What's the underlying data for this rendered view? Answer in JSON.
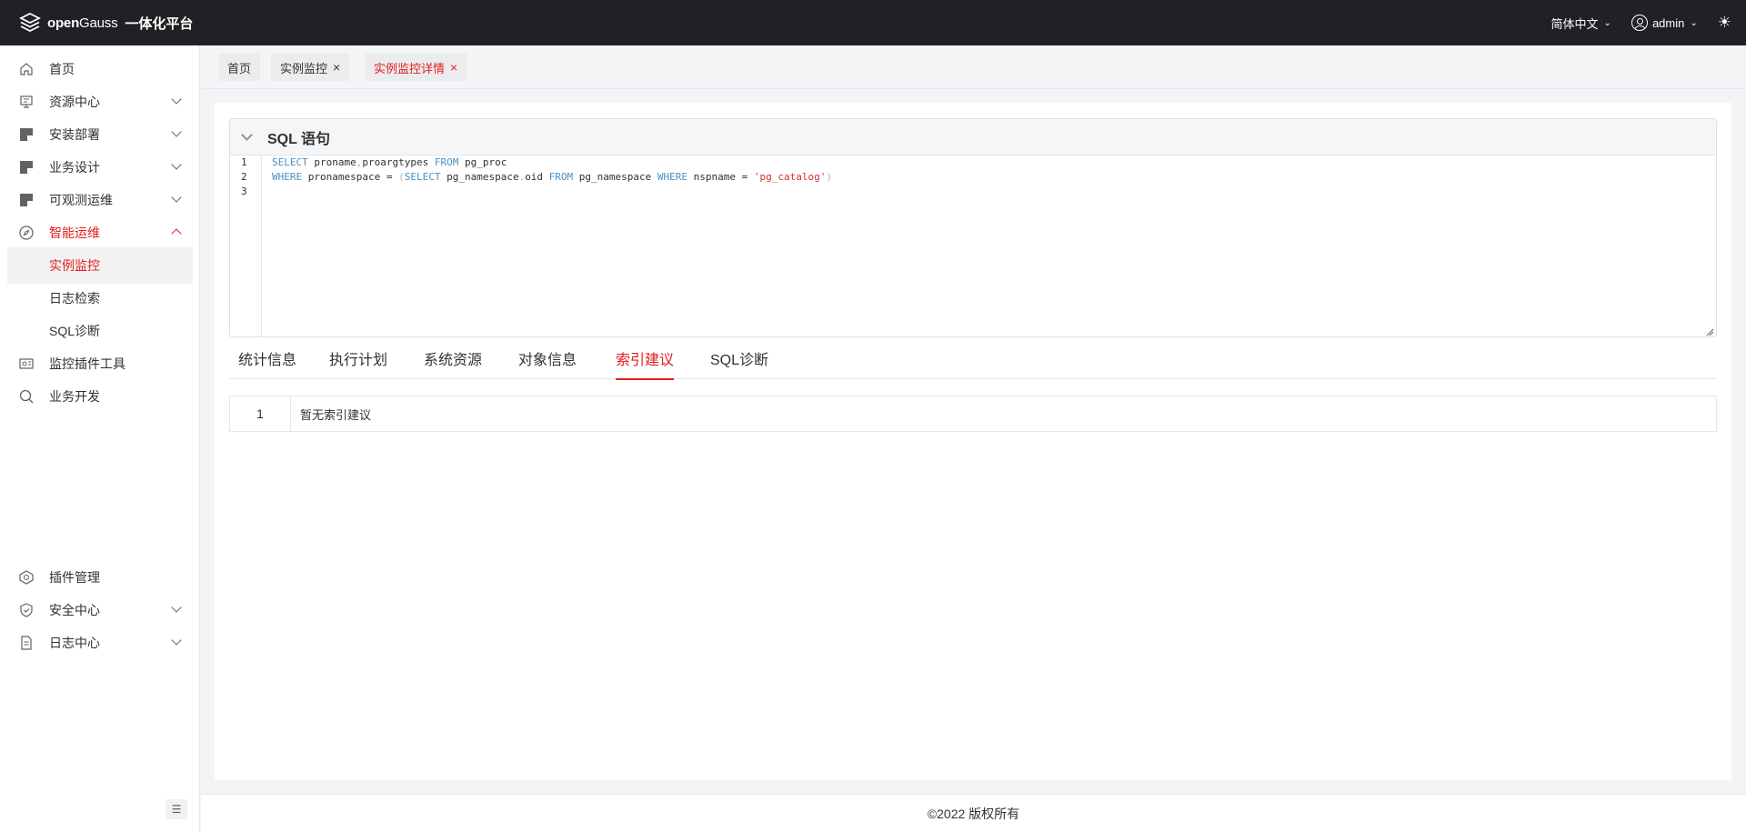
{
  "header": {
    "logo_text_open": "open",
    "logo_text_gauss": "Gauss",
    "platform_name": "一体化平台",
    "language": "简体中文",
    "user": "admin"
  },
  "sidebar": {
    "items": [
      {
        "label": "首页",
        "icon": "home-icon"
      },
      {
        "label": "资源中心",
        "icon": "resource-icon"
      },
      {
        "label": "安装部署",
        "icon": "install-icon"
      },
      {
        "label": "业务设计",
        "icon": "design-icon"
      },
      {
        "label": "可观测运维",
        "icon": "observe-icon"
      },
      {
        "label": "智能运维",
        "icon": "compass-icon"
      },
      {
        "label": "监控插件工具",
        "icon": "plugin-tool-icon"
      },
      {
        "label": "业务开发",
        "icon": "search-icon"
      },
      {
        "label": "插件管理",
        "icon": "plugin-manage-icon"
      },
      {
        "label": "安全中心",
        "icon": "shield-icon"
      },
      {
        "label": "日志中心",
        "icon": "log-icon"
      }
    ],
    "subitems": [
      {
        "label": "实例监控"
      },
      {
        "label": "日志检索"
      },
      {
        "label": "SQL诊断"
      }
    ]
  },
  "tags": [
    {
      "label": "首页"
    },
    {
      "label": "实例监控"
    },
    {
      "label": "实例监控详情"
    }
  ],
  "editor": {
    "title": "SQL 语句",
    "line_numbers": [
      "1",
      "2",
      "3"
    ]
  },
  "tabs": [
    {
      "label": "统计信息"
    },
    {
      "label": "执行计划"
    },
    {
      "label": "系统资源"
    },
    {
      "label": "对象信息"
    },
    {
      "label": "索引建议"
    },
    {
      "label": "SQL诊断"
    }
  ],
  "result": {
    "index": "1",
    "message": "暂无索引建议"
  },
  "footer": {
    "copyright": "©2022 版权所有"
  },
  "colors": {
    "accent": "#e41d1d",
    "topbar": "#202124"
  }
}
